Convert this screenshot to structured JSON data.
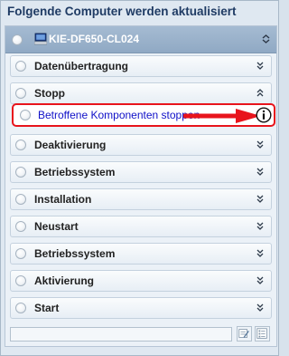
{
  "title": "Folgende Computer werden aktualisiert",
  "computer": {
    "name": "KIE-DF650-CL024",
    "icon": "computer-icon"
  },
  "steps": [
    {
      "label": "Datenübertragung",
      "state": "collapsed"
    },
    {
      "label": "Stopp",
      "state": "expanded"
    },
    {
      "label": "Deaktivierung",
      "state": "collapsed"
    },
    {
      "label": "Betriebssystem",
      "state": "collapsed"
    },
    {
      "label": "Installation",
      "state": "collapsed"
    },
    {
      "label": "Neustart",
      "state": "collapsed"
    },
    {
      "label": "Betriebssystem",
      "state": "collapsed"
    },
    {
      "label": "Aktivierung",
      "state": "collapsed"
    },
    {
      "label": "Start",
      "state": "collapsed"
    }
  ],
  "substep": {
    "label": "Betroffene Komponenten stoppen",
    "icon": "info-icon"
  },
  "footer": {
    "input_value": "",
    "buttons": [
      "edit-list-icon",
      "checklist-icon"
    ]
  },
  "colors": {
    "header_bg": "#9fb5cd",
    "highlight_border": "#e8141c",
    "link_text": "#1010c8",
    "title_text": "#1f3b64"
  }
}
